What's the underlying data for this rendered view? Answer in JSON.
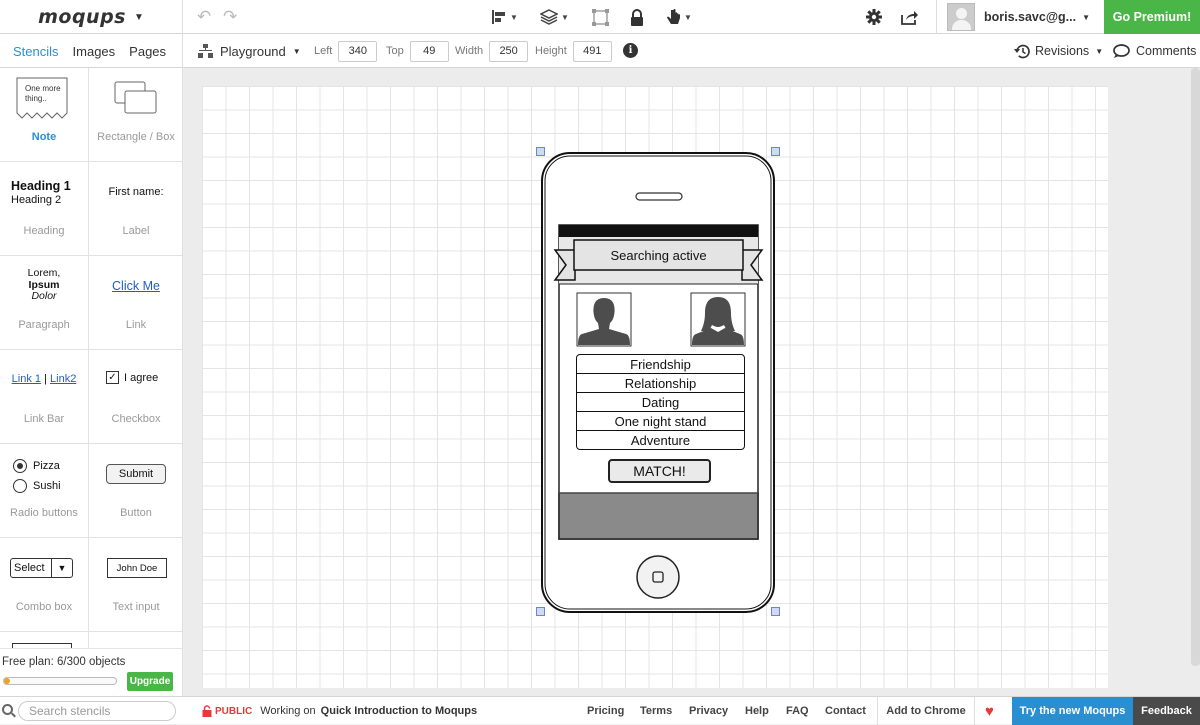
{
  "app": {
    "logo": "moqups"
  },
  "user": {
    "email": "boris.savc@g..."
  },
  "header": {
    "premium_label": "Go Premium!"
  },
  "tabs": [
    {
      "label": "Stencils"
    },
    {
      "label": "Images"
    },
    {
      "label": "Pages"
    }
  ],
  "page_selector": {
    "label": "Playground"
  },
  "dimensions": {
    "left_label": "Left",
    "left": "340",
    "top_label": "Top",
    "top": "49",
    "width_label": "Width",
    "width": "250",
    "height_label": "Height",
    "height": "491"
  },
  "revisions": {
    "label": "Revisions"
  },
  "comments": {
    "label": "Comments"
  },
  "stencils": [
    {
      "label": "Note",
      "preview": "One more thing.."
    },
    {
      "label": "Rectangle / Box"
    },
    {
      "label": "Heading",
      "preview1": "Heading 1",
      "preview2": "Heading 2"
    },
    {
      "label": "Label",
      "preview": "First name:"
    },
    {
      "label": "Paragraph",
      "preview1": "Lorem,",
      "preview2": "Ipsum",
      "preview3": "Dolor"
    },
    {
      "label": "Link",
      "preview": "Click Me"
    },
    {
      "label": "Link Bar",
      "preview1": "Link 1",
      "preview2": "Link2"
    },
    {
      "label": "Checkbox",
      "preview": "I agree"
    },
    {
      "label": "Radio buttons",
      "preview1": "Pizza",
      "preview2": "Sushi"
    },
    {
      "label": "Button",
      "preview": "Submit"
    },
    {
      "label": "Combo box",
      "preview": "Select"
    },
    {
      "label": "Text input",
      "preview": "John Doe"
    }
  ],
  "freeplan": {
    "text": "Free plan: 6/300 objects",
    "progress": 0.02,
    "upgrade_label": "Upgrade"
  },
  "mockup": {
    "banner": "Searching active",
    "options": [
      "Friendship",
      "Relationship",
      "Dating",
      "One night stand",
      "Adventure"
    ],
    "match": "MATCH!"
  },
  "footer": {
    "search_placeholder": "Search stencils",
    "public_label": "PUBLIC",
    "working_on": "Working on",
    "project": "Quick Introduction to Moqups",
    "links": [
      "Pricing",
      "Terms",
      "Privacy",
      "Help",
      "FAQ",
      "Contact"
    ],
    "add_chrome": "Add to Chrome",
    "try_new": "Try the new Moqups",
    "feedback": "Feedback"
  },
  "colors": {
    "accent": "#2a8fd1",
    "premium": "#4bb648",
    "progress": "#f0a020",
    "public": "#e03c3c"
  }
}
